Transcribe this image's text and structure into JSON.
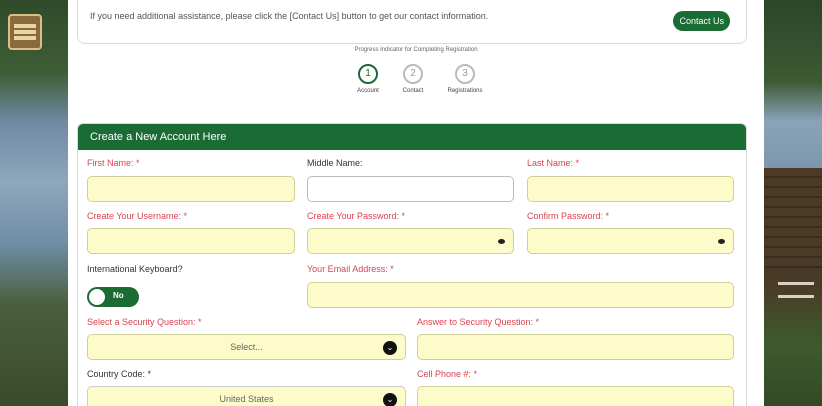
{
  "info": {
    "text": "If you need additional assistance, please click the [Contact Us] button to get our contact information.",
    "contact_button": "Contact Us"
  },
  "progress": {
    "title": "Progress Indicator for Completing Registration",
    "steps": [
      {
        "number": "1",
        "label": "Account",
        "active": true
      },
      {
        "number": "2",
        "label": "Contact",
        "active": false
      },
      {
        "number": "3",
        "label": "Registrations",
        "active": false
      }
    ]
  },
  "form": {
    "header": "Create a New Account Here",
    "first_name_label": "First Name: *",
    "middle_name_label": "Middle Name:",
    "last_name_label": "Last Name: *",
    "username_label": "Create Your Username: *",
    "password_label": "Create Your Password: *",
    "confirm_password_label": "Confirm Password: *",
    "intl_keyboard_label": "International Keyboard?",
    "intl_keyboard_toggle": "No",
    "email_label": "Your Email Address: *",
    "security_question_label": "Select a Security Question: *",
    "security_question_value": "Select...",
    "security_answer_label": "Answer to Security Question: *",
    "country_code_label": "Country Code: *",
    "country_code_value": "United States",
    "cell_phone_label": "Cell Phone #: *"
  },
  "colors": {
    "brand_green": "#1b6b35",
    "required_red": "#d9434f",
    "input_yellow": "#fdfbc9"
  }
}
